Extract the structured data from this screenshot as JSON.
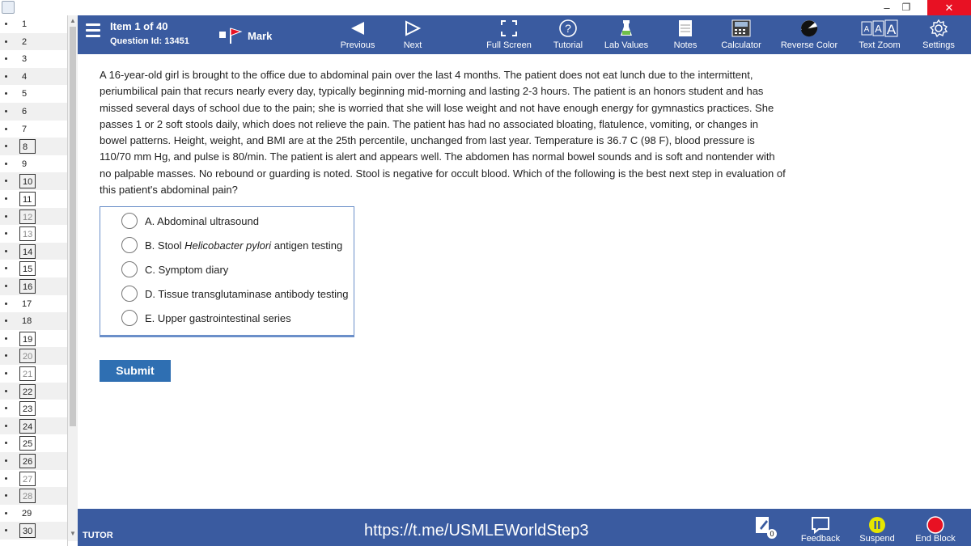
{
  "window": {
    "minimize": "–",
    "maximize": "❐",
    "close": "✕"
  },
  "question_list": {
    "items": [
      {
        "n": "1",
        "marked": false,
        "fade": false
      },
      {
        "n": "2",
        "marked": false,
        "fade": false
      },
      {
        "n": "3",
        "marked": false,
        "fade": false
      },
      {
        "n": "4",
        "marked": false,
        "fade": false
      },
      {
        "n": "5",
        "marked": false,
        "fade": false
      },
      {
        "n": "6",
        "marked": false,
        "fade": false
      },
      {
        "n": "7",
        "marked": false,
        "fade": false
      },
      {
        "n": "8",
        "marked": true,
        "fade": false
      },
      {
        "n": "9",
        "marked": false,
        "fade": false
      },
      {
        "n": "10",
        "marked": true,
        "fade": false
      },
      {
        "n": "11",
        "marked": true,
        "fade": false
      },
      {
        "n": "12",
        "marked": true,
        "fade": true
      },
      {
        "n": "13",
        "marked": true,
        "fade": true
      },
      {
        "n": "14",
        "marked": true,
        "fade": false
      },
      {
        "n": "15",
        "marked": true,
        "fade": false
      },
      {
        "n": "16",
        "marked": true,
        "fade": false
      },
      {
        "n": "17",
        "marked": false,
        "fade": false
      },
      {
        "n": "18",
        "marked": false,
        "fade": false
      },
      {
        "n": "19",
        "marked": true,
        "fade": false
      },
      {
        "n": "20",
        "marked": true,
        "fade": true
      },
      {
        "n": "21",
        "marked": true,
        "fade": true
      },
      {
        "n": "22",
        "marked": true,
        "fade": false
      },
      {
        "n": "23",
        "marked": true,
        "fade": false
      },
      {
        "n": "24",
        "marked": true,
        "fade": false
      },
      {
        "n": "25",
        "marked": true,
        "fade": false
      },
      {
        "n": "26",
        "marked": true,
        "fade": false
      },
      {
        "n": "27",
        "marked": true,
        "fade": true
      },
      {
        "n": "28",
        "marked": true,
        "fade": true
      },
      {
        "n": "29",
        "marked": false,
        "fade": false
      },
      {
        "n": "30",
        "marked": true,
        "fade": false
      }
    ]
  },
  "toolbar": {
    "item": "Item 1 of 40",
    "question_id": "Question Id: 13451",
    "mark": "Mark",
    "previous": "Previous",
    "next": "Next",
    "full_screen": "Full Screen",
    "tutorial": "Tutorial",
    "lab_values": "Lab Values",
    "notes": "Notes",
    "calculator": "Calculator",
    "reverse_color": "Reverse Color",
    "text_zoom": "Text Zoom",
    "settings": "Settings"
  },
  "question": {
    "stem": "A 16-year-old girl is brought to the office due to abdominal pain over the last 4 months.  The patient does not eat lunch due to the intermittent, periumbilical pain that recurs nearly every day, typically beginning mid-morning and lasting 2-3 hours.  The patient is an honors student and has missed several days of school due to the pain; she is worried that she will lose weight and not have enough energy for gymnastics practices.  She passes 1 or 2 soft stools daily, which does not relieve the pain.  The patient has had no associated bloating, flatulence, vomiting, or changes in bowel patterns.  Height, weight, and BMI are at the 25th percentile, unchanged from last year.  Temperature is 36.7 C (98 F), blood pressure is 110/70 mm Hg, and pulse is 80/min.  The patient is alert and appears well.  The abdomen has normal bowel sounds and is soft and nontender with no palpable masses.  No rebound or guarding is noted.  Stool is negative for occult blood.  Which of the following is the best next step in evaluation of this patient's abdominal pain?",
    "answers": [
      {
        "label": "A.  Abdominal ultrasound",
        "pre": "",
        "italic": "",
        "post": ""
      },
      {
        "label": "B.  Stool ",
        "pre": "",
        "italic": "Helicobacter pylori",
        "post": " antigen testing"
      },
      {
        "label": "C.  Symptom diary",
        "pre": "",
        "italic": "",
        "post": ""
      },
      {
        "label": "D.  Tissue transglutaminase antibody testing",
        "pre": "",
        "italic": "",
        "post": ""
      },
      {
        "label": "E.  Upper gastrointestinal series",
        "pre": "",
        "italic": "",
        "post": ""
      }
    ],
    "submit": "Submit"
  },
  "bottombar": {
    "mode": "TUTOR",
    "link": "https://t.me/USMLEWorldStep3",
    "notes_badge": "0",
    "feedback": "Feedback",
    "suspend": "Suspend",
    "end_block": "End Block"
  },
  "colors": {
    "toolbar": "#3a5ba0",
    "submit": "#2f6fb2",
    "suspend": "#e6e600",
    "end_block": "#e81123"
  }
}
